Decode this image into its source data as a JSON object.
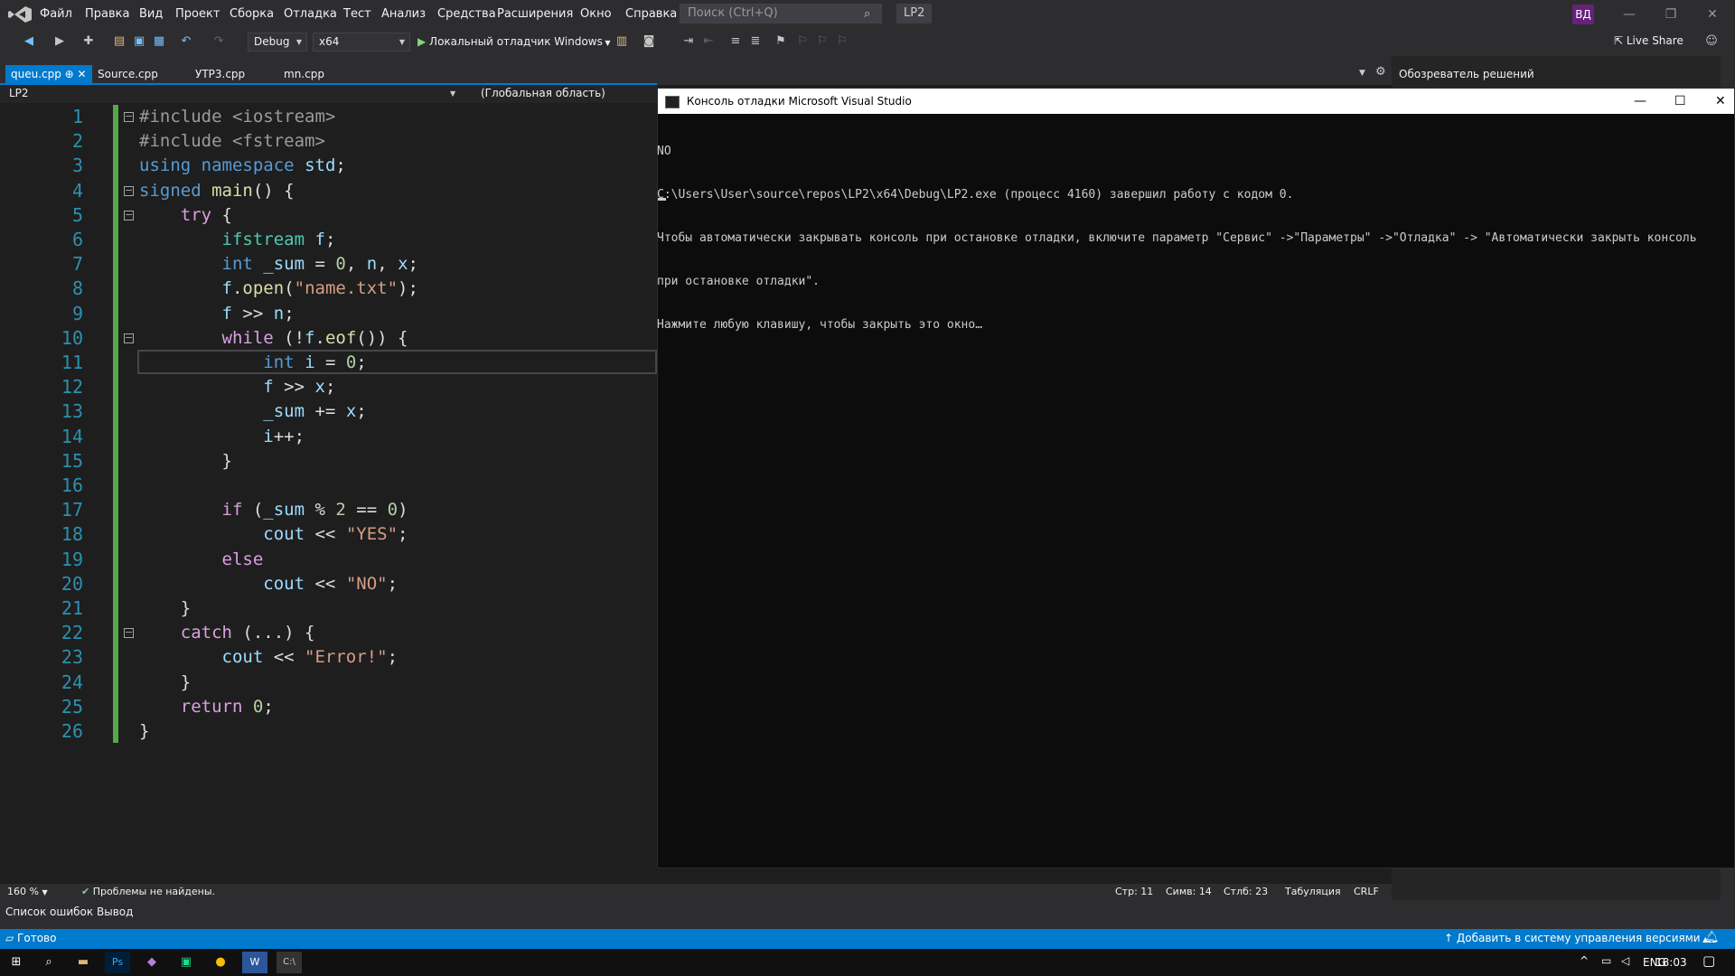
{
  "menu": [
    "Файл",
    "Правка",
    "Вид",
    "Проект",
    "Сборка",
    "Отладка",
    "Тест",
    "Анализ",
    "Средства",
    "Расширения",
    "Окно",
    "Справка"
  ],
  "search": {
    "placeholder": "Поиск (Ctrl+Q)"
  },
  "solution_badge": "LP2",
  "user_initials": "ВД",
  "toolbar": {
    "config": "Debug",
    "platform": "x64",
    "debugger": "Локальный отладчик Windows",
    "live_share": "Live Share"
  },
  "tabs": [
    "queu.cpp",
    "Source.cpp",
    "УТР3.cpp",
    "mn.cpp"
  ],
  "nav": {
    "project": "LP2",
    "scope": "(Глобальная область)"
  },
  "solution_explorer": "Обозреватель решений",
  "code_lines": [
    "#include <iostream>",
    "#include <fstream>",
    "using namespace std;",
    "signed main() {",
    "    try {",
    "        ifstream f;",
    "        int _sum = 0, n, x;",
    "        f.open(\"name.txt\");",
    "        f >> n;",
    "        while (!f.eof()) {",
    "            int i = 0;",
    "            f >> x;",
    "            _sum += x;",
    "            i++;",
    "        }",
    "",
    "        if (_sum % 2 == 0)",
    "            cout << \"YES\";",
    "        else",
    "            cout << \"NO\";",
    "    }",
    "    catch (...) {",
    "        cout << \"Error!\";",
    "    }",
    "    return 0;",
    "}"
  ],
  "editor_status": {
    "zoom": "160 %",
    "problems": "Проблемы не найдены.",
    "line": "Стр: 11",
    "char": "Симв: 14",
    "col": "Стлб: 23",
    "tabs": "Табуляция",
    "eol": "CRLF"
  },
  "bottom_tabs": [
    "Список ошибок",
    "Вывод"
  ],
  "statusbar": {
    "ready": "Готово",
    "vcs": "Добавить в систему управления версиями"
  },
  "console": {
    "title": "Консоль отладки Microsoft Visual Studio",
    "lines": [
      "NO",
      "C:\\Users\\User\\source\\repos\\LP2\\x64\\Debug\\LP2.exe (процесс 4160) завершил работу с кодом 0.",
      "Чтобы автоматически закрывать консоль при остановке отладки, включите параметр \"Сервис\" ->\"Параметры\" ->\"Отладка\" -> \"Автоматически закрыть консоль",
      "при остановке отладки\".",
      "Нажмите любую клавишу, чтобы закрыть это окно…"
    ]
  },
  "taskbar": {
    "lang": "ENG",
    "time": "18:03"
  }
}
